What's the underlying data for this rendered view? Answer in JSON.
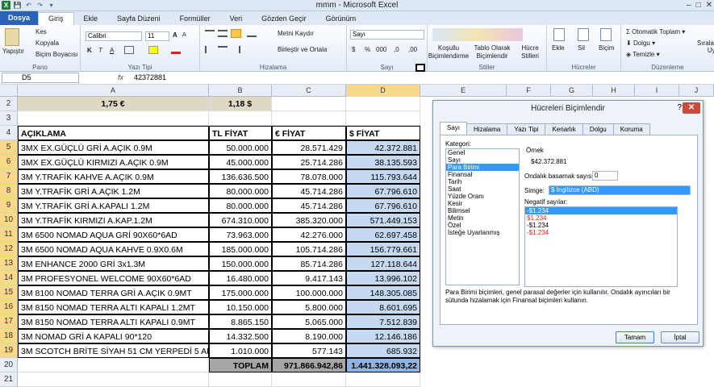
{
  "window": {
    "title": "mmm - Microsoft Excel",
    "controls": [
      "–",
      "□",
      "✕"
    ]
  },
  "quick_access": [
    "X",
    "💾",
    "↶",
    "↷",
    "▾"
  ],
  "tabs": [
    "Dosya",
    "Giriş",
    "Ekle",
    "Sayfa Düzeni",
    "Formüller",
    "Veri",
    "Gözden Geçir",
    "Görünüm"
  ],
  "ribbon": {
    "clipboard": {
      "paste": "Yapıştır",
      "cut": "Kes",
      "copy": "Kopyala",
      "format_painter": "Biçim Boyacısı",
      "label": "Pano"
    },
    "font": {
      "name": "Calibri",
      "size": "11",
      "bold": "K",
      "italic": "T",
      "underline": "A",
      "grow": "A",
      "shrink": "A",
      "label": "Yazı Tipi"
    },
    "alignment": {
      "wrap": "Metni Kaydır",
      "merge": "Birleştir ve Ortala",
      "label": "Hizalama"
    },
    "number": {
      "format": "Sayı",
      "currency": "$",
      "percent": "%",
      "comma": "000",
      "inc": ",0",
      "dec": ",00",
      "label": "Sayı"
    },
    "styles": {
      "conditional": "Koşullu Biçimlendirme",
      "table": "Tablo Olarak Biçimlendir",
      "cell": "Hücre Stilleri",
      "label": "Stiller"
    },
    "cells": {
      "insert": "Ekle",
      "delete": "Sil",
      "format": "Biçim",
      "label": "Hücreler"
    },
    "editing": {
      "autosum": "Otomatik Toplam",
      "fill": "Dolgu",
      "clear": "Temizle",
      "sort": "Sırala ve",
      "sort2": "Uygu",
      "label": "Düzenleme"
    }
  },
  "formula_bar": {
    "name_box": "D5",
    "fx": "fx",
    "value": "42372881"
  },
  "columns": [
    "A",
    "B",
    "C",
    "D",
    "E",
    "F",
    "G",
    "H",
    "I",
    "J"
  ],
  "rows": [
    {
      "n": "2",
      "a": "1,75 €",
      "b": "1,18 $",
      "c": "",
      "d": ""
    },
    {
      "n": "3",
      "a": "",
      "b": "",
      "c": "",
      "d": ""
    },
    {
      "n": "4",
      "a": "AÇIKLAMA",
      "b": "TL FİYAT",
      "c": "€ FİYAT",
      "d": "$ FİYAT"
    },
    {
      "n": "5",
      "a": "3MX EX.GÜÇLÜ GRİ A.AÇIK 0.9M",
      "b": "50.000.000",
      "c": "28.571.429",
      "d": "42.372.881"
    },
    {
      "n": "6",
      "a": "3MX EX.GÜÇLÜ KIRMIZI A.AÇIK 0.9M",
      "b": "45.000.000",
      "c": "25.714.286",
      "d": "38.135.593"
    },
    {
      "n": "7",
      "a": "3M Y.TRAFİK KAHVE A.AÇIK 0.9M",
      "b": "136.636.500",
      "c": "78.078.000",
      "d": "115.793.644"
    },
    {
      "n": "8",
      "a": "3M Y.TRAFİK GRİ A.AÇIK 1.2M",
      "b": "80.000.000",
      "c": "45.714.286",
      "d": "67.796.610"
    },
    {
      "n": "9",
      "a": "3M Y.TRAFİK GRİ A.KAPALI 1.2M",
      "b": "80.000.000",
      "c": "45.714.286",
      "d": "67.796.610"
    },
    {
      "n": "10",
      "a": "3M Y.TRAFİK KIRMIZI A.KAP.1.2M",
      "b": "674.310.000",
      "c": "385.320.000",
      "d": "571.449.153"
    },
    {
      "n": "11",
      "a": "3M 6500 NOMAD AQUA GRİ 90X60*6AD",
      "b": "73.963.000",
      "c": "42.276.000",
      "d": "62.697.458"
    },
    {
      "n": "12",
      "a": "3M 6500 NOMAD AQUA KAHVE 0.9X0.6M",
      "b": "185.000.000",
      "c": "105.714.286",
      "d": "156.779.661"
    },
    {
      "n": "13",
      "a": "3M ENHANCE 2000 GRİ 3x1.3M",
      "b": "150.000.000",
      "c": "85.714.286",
      "d": "127.118.644"
    },
    {
      "n": "14",
      "a": "3M PROFESYONEL WELCOME 90X60*6AD",
      "b": "16.480.000",
      "c": "9.417.143",
      "d": "13.996.102"
    },
    {
      "n": "15",
      "a": "3M 8100 NOMAD TERRA GRİ A.AÇIK 0.9MT",
      "b": "175.000.000",
      "c": "100.000.000",
      "d": "148.305.085"
    },
    {
      "n": "16",
      "a": "3M 8150 NOMAD TERRA ALTI KAPALI 1.2MT",
      "b": "10.150.000",
      "c": "5.800.000",
      "d": "8.601.695"
    },
    {
      "n": "17",
      "a": "3M 8150  NOMAD TERRA ALTI KAPALI 0.9MT",
      "b": "8.865.150",
      "c": "5.065.000",
      "d": "7.512.839"
    },
    {
      "n": "18",
      "a": "3M NOMAD GRİ A KAPALI 90*120",
      "b": "14.332.500",
      "c": "8.190.000",
      "d": "12.146.186"
    },
    {
      "n": "19",
      "a": "3M SCOTCH BRİTE SİYAH 51 CM YERPEDİ 5 AD",
      "b": "1.010.000",
      "c": "577.143",
      "d": "685.932"
    },
    {
      "n": "20",
      "a": "",
      "b": "TOPLAM",
      "c": "971.866.942,86",
      "d": "1.441.328.093,22"
    },
    {
      "n": "21",
      "a": "",
      "b": "",
      "c": "",
      "d": ""
    }
  ],
  "dialog": {
    "title": "Hücreleri Biçimlendir",
    "help": "?",
    "close": "✕",
    "tabs": [
      "Sayı",
      "Hizalama",
      "Yazı Tipi",
      "Kenarlık",
      "Dolgu",
      "Koruma"
    ],
    "category_label": "Kategori:",
    "categories": [
      "Genel",
      "Sayı",
      "Para Birimi",
      "Finansal",
      "Tarih",
      "Saat",
      "Yüzde Oranı",
      "Kesir",
      "Bilimsel",
      "Metin",
      "Özel",
      "İsteğe Uyarlanmış"
    ],
    "selected_category": "Para Birimi",
    "sample_label": "Örnek",
    "sample_value": "$42.372.881",
    "decimal_label": "Ondalık basamak sayısı:",
    "decimal_value": "0",
    "symbol_label": "Simge:",
    "symbol_value": "$ İngilizce (ABD)",
    "negative_label": "Negatif sayılar:",
    "negatives": [
      "-$1.234",
      "$1.234",
      "-$1.234",
      "-$1.234"
    ],
    "description": "Para Birimi biçimleri, genel parasal değerler için kullanılır. Ondalık ayırıcıları bir sütunda hizalamak için Finansal biçimleri kullanın.",
    "ok": "Tamam",
    "cancel": "İptal"
  },
  "colors": {
    "selected_col": "#c5d9f1",
    "header_tan": "#ddd9c4",
    "total_gray": "#a6a6a6",
    "accent": "#2a62b8",
    "negative_red": "#e02020"
  }
}
